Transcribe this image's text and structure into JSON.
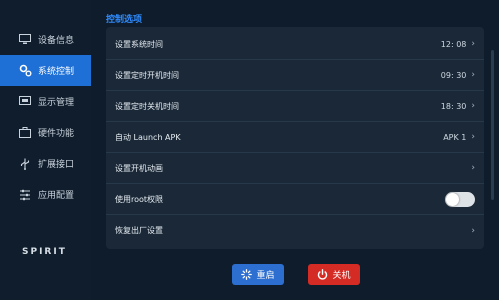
{
  "sidebar": {
    "items": [
      {
        "label": "设备信息",
        "icon": "monitor-icon"
      },
      {
        "label": "系统控制",
        "icon": "gears-icon",
        "active": true
      },
      {
        "label": "显示管理",
        "icon": "display-icon"
      },
      {
        "label": "硬件功能",
        "icon": "briefcase-icon"
      },
      {
        "label": "扩展接口",
        "icon": "usb-icon"
      },
      {
        "label": "应用配置",
        "icon": "sliders-icon"
      }
    ],
    "brand": "SPIRIT"
  },
  "main": {
    "section_title": "控制选项",
    "rows": [
      {
        "label": "设置系统时间",
        "value": "12: 08"
      },
      {
        "label": "设置定时开机时间",
        "value": "09: 30"
      },
      {
        "label": "设置定时关机时间",
        "value": "18: 30"
      },
      {
        "label": "自动 Launch APK",
        "value": "APK 1"
      },
      {
        "label": "设置开机动画",
        "value": ""
      },
      {
        "label": "使用root权限",
        "toggle": false
      },
      {
        "label": "恢复出厂设置",
        "value": ""
      }
    ]
  },
  "buttons": {
    "restart": "重启",
    "shutdown": "关机"
  },
  "colors": {
    "accent": "#1e6fd6",
    "restart": "#2d6fd0",
    "shutdown": "#d52b25",
    "section_title": "#2f8cff"
  }
}
